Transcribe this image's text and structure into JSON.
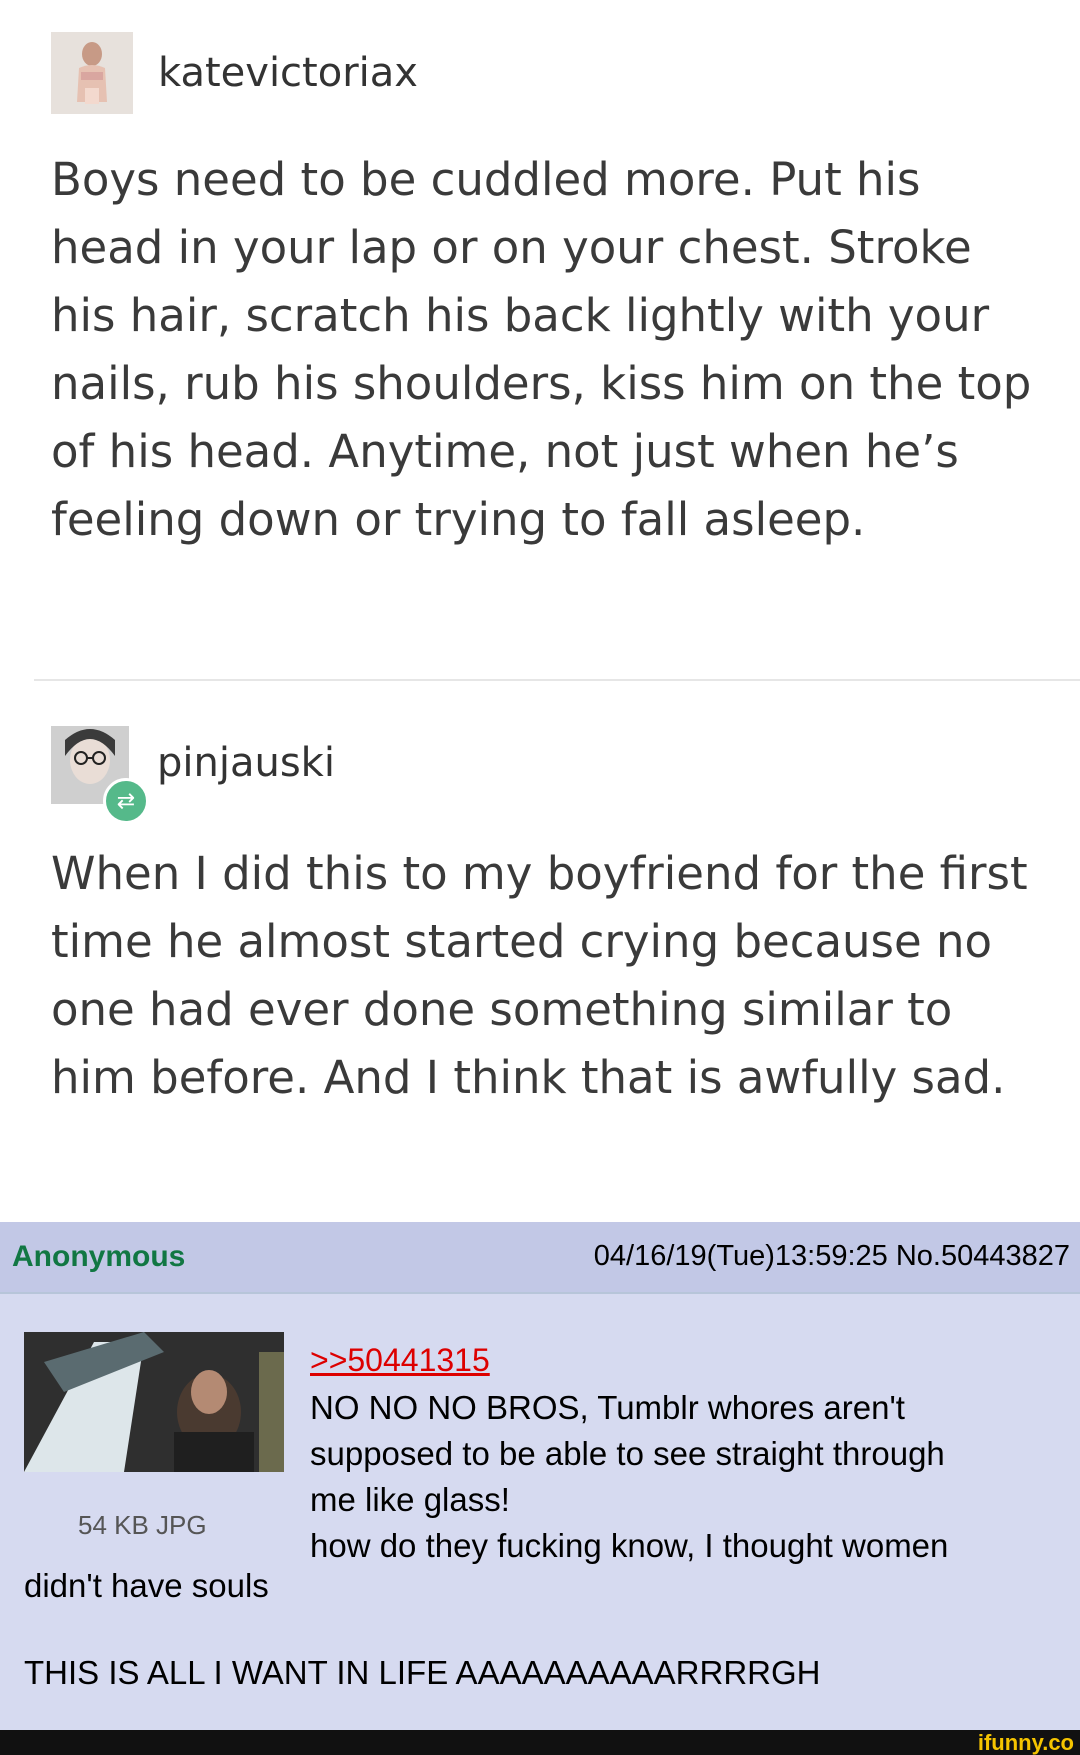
{
  "tumblr": {
    "post1": {
      "username": "katevictoriax",
      "text": "Boys need to be cuddled more. Put his head in your lap or on your chest. Stroke his hair, scratch his back lightly with your nails, rub his shoulders, kiss him on the top of his head. Anytime, not just when he’s feeling down or trying to fall asleep."
    },
    "post2": {
      "username": "pinjauski",
      "reblog_icon": "reblog-icon",
      "text": "When I did this to my boyfriend for the first time he almost started crying because no one had ever done something similar to him before. And I think that is awfully sad."
    }
  },
  "chan": {
    "name": "Anonymous",
    "meta": "04/16/19(Tue)13:59:25 No.50443827",
    "file_info": "54 KB JPG",
    "reply_link": ">>50441315",
    "lines": [
      "NO NO NO BROS, Tumblr whores aren't",
      "supposed to be able to see straight through",
      "me like glass!",
      "how do they fucking know, I thought women"
    ],
    "tail": "didn't have souls",
    "shout": "THIS IS ALL I WANT IN LIFE AAAAAAAAAARRRRGH"
  },
  "footer": {
    "watermark": "ifunny.co"
  },
  "colors": {
    "chan_bg": "#d6daf0",
    "chan_header": "#c2c8e6",
    "anon_green": "#117743",
    "reply_red": "#dd0000",
    "reblog_green": "#55b98a"
  }
}
